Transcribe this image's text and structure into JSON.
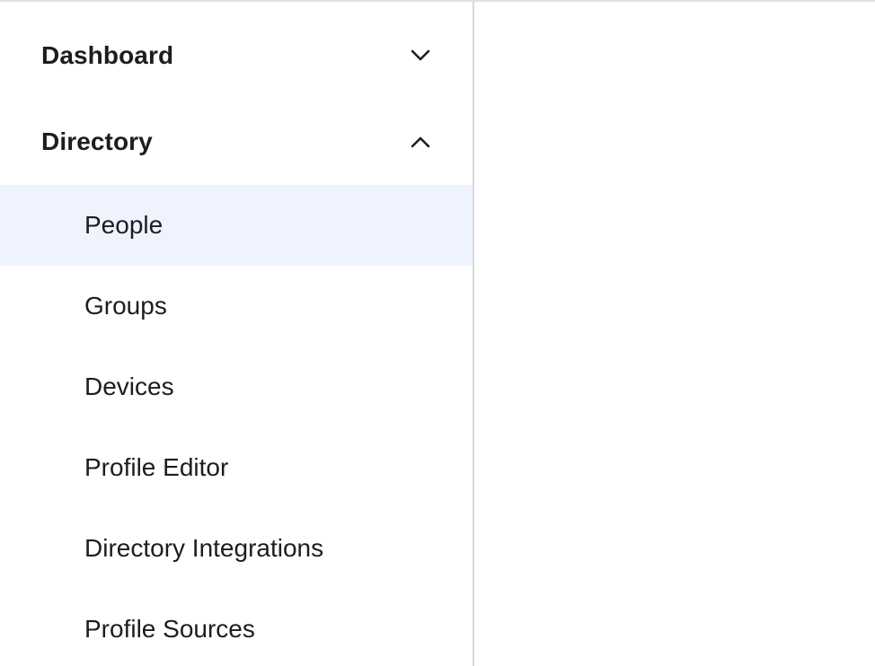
{
  "sidebar": {
    "sections": [
      {
        "label": "Dashboard",
        "expanded": false,
        "icon": "chevron-down-icon"
      },
      {
        "label": "Directory",
        "expanded": true,
        "icon": "chevron-up-icon"
      }
    ],
    "directory_items": [
      {
        "label": "People",
        "active": true
      },
      {
        "label": "Groups",
        "active": false
      },
      {
        "label": "Devices",
        "active": false
      },
      {
        "label": "Profile Editor",
        "active": false
      },
      {
        "label": "Directory Integrations",
        "active": false
      },
      {
        "label": "Profile Sources",
        "active": false
      }
    ]
  },
  "colors": {
    "active_background": "#eff3fd",
    "text": "#1d1d21",
    "divider": "#d7d8de"
  }
}
